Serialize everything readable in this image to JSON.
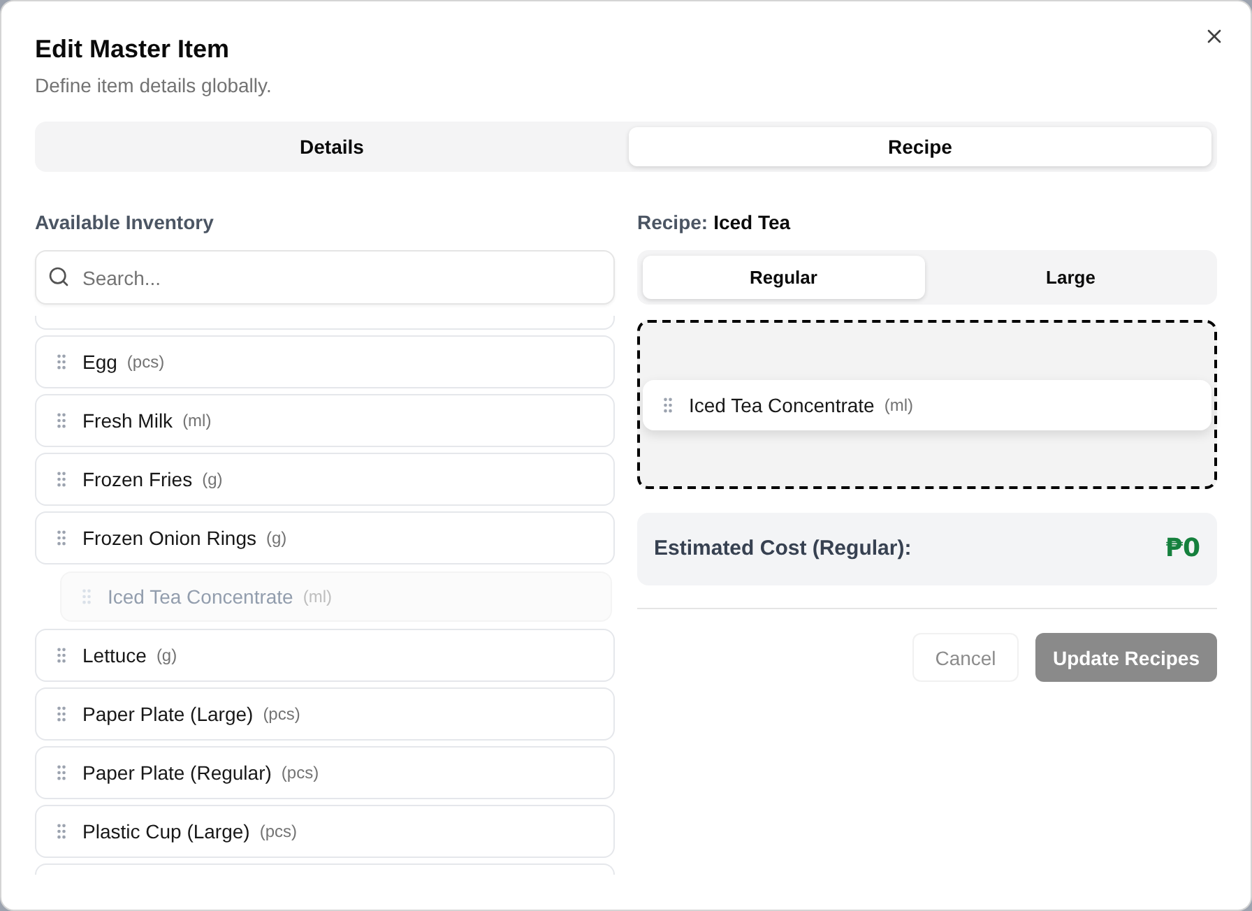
{
  "dialog": {
    "title": "Edit Master Item",
    "description": "Define item details globally."
  },
  "tabs": [
    {
      "label": "Details",
      "selected": false
    },
    {
      "label": "Recipe",
      "selected": true
    }
  ],
  "inventory": {
    "heading": "Available Inventory",
    "search": {
      "placeholder": "Search..."
    },
    "items": [
      {
        "name": "Egg",
        "unit": "(pcs)",
        "ghost": false
      },
      {
        "name": "Fresh Milk",
        "unit": "(ml)",
        "ghost": false
      },
      {
        "name": "Frozen Fries",
        "unit": "(g)",
        "ghost": false
      },
      {
        "name": "Frozen Onion Rings",
        "unit": "(g)",
        "ghost": false
      },
      {
        "name": "Iced Tea Concentrate",
        "unit": "(ml)",
        "ghost": true
      },
      {
        "name": "Lettuce",
        "unit": "(g)",
        "ghost": false
      },
      {
        "name": "Paper Plate (Large)",
        "unit": "(pcs)",
        "ghost": false
      },
      {
        "name": "Paper Plate (Regular)",
        "unit": "(pcs)",
        "ghost": false
      },
      {
        "name": "Plastic Cup (Large)",
        "unit": "(pcs)",
        "ghost": false
      }
    ]
  },
  "recipe": {
    "label": "Recipe:",
    "name": "Iced Tea",
    "sizes": [
      {
        "label": "Regular",
        "selected": true
      },
      {
        "label": "Large",
        "selected": false
      }
    ],
    "ingredients": [
      {
        "name": "Iced Tea Concentrate",
        "unit": "(ml)"
      }
    ],
    "cost": {
      "label": "Estimated Cost (Regular):",
      "value": "₱0"
    }
  },
  "buttons": [
    {
      "label": "Cancel",
      "kind": "secondary",
      "disabled": true
    },
    {
      "label": "Update Recipes",
      "kind": "primary",
      "disabled": true
    }
  ]
}
